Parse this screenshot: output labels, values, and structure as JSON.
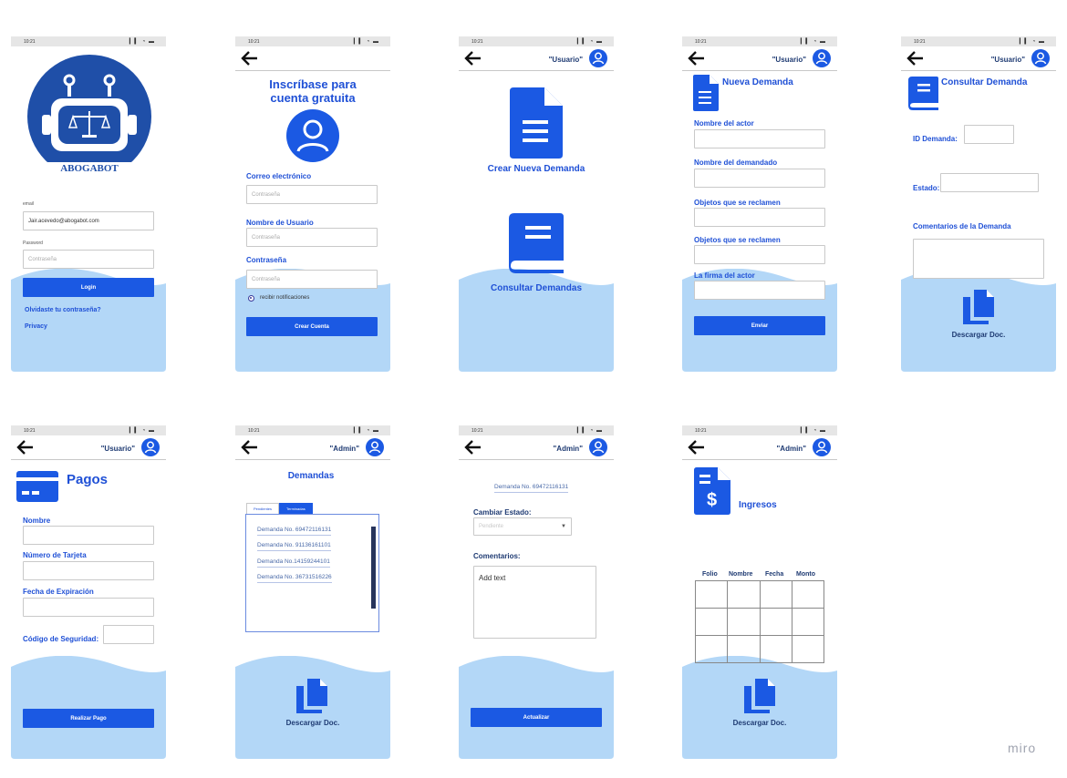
{
  "status_bar": {
    "time": "10:21",
    "signal": "▎▎ ● ▬"
  },
  "miro": "miro",
  "login": {
    "brand": "ABOGABOT",
    "email_label": "email",
    "email_value": "Jair.acevedo@abogabot.com",
    "password_label": "Password",
    "password_placeholder": "Contraseña",
    "login_button": "Login",
    "forgot_link": "Olvidaste tu contraseña?",
    "privacy_link": "Privacy"
  },
  "signup": {
    "title_line1": "Inscríbase para",
    "title_line2": "cuenta gratuita",
    "email_label": "Correo electrónico",
    "email_placeholder": "Contraseña",
    "username_label": "Nombre de Usuario",
    "username_placeholder": "Contraseña",
    "password_label": "Contraseña",
    "password_placeholder": "Contraseña",
    "notify_label": "recibir notificaciones",
    "create_button": "Crear Cuenta"
  },
  "home": {
    "user": "\"Usuario\"",
    "create_label": "Crear Nueva Demanda",
    "consult_label": "Consultar Demandas"
  },
  "new_demand": {
    "user": "\"Usuario\"",
    "title": "Nueva Demanda",
    "actor_label": "Nombre del actor",
    "defendant_label": "Nombre del demandado",
    "objects_label_1": "Objetos que se reclamen",
    "objects_label_2": "Objetos que se reclamen",
    "signature_label": "La firma del actor",
    "send_button": "Enviar"
  },
  "consult_demand": {
    "user": "\"Usuario\"",
    "title": "Consultar Demanda",
    "id_label": "ID Demanda:",
    "status_label": "Estado:",
    "comments_label": "Comentarios de la Demanda",
    "download_label": "Descargar Doc."
  },
  "payments": {
    "user": "\"Usuario\"",
    "title": "Pagos",
    "name_label": "Nombre",
    "card_label": "Número de Tarjeta",
    "expiry_label": "Fecha de Expiración",
    "security_label": "Código de Seguridad:",
    "pay_button": "Realizar Pago"
  },
  "admin_demands": {
    "user": "\"Admin\"",
    "title": "Demandas",
    "tab_pending": "Pendientes",
    "tab_done": "Terminadas",
    "items": [
      "Demanda No. 69472116131",
      "Demanda No. 91136161101",
      "Demanda No.14159244101",
      "Demanda No. 36731516226"
    ],
    "download_label": "Descargar Doc."
  },
  "admin_update": {
    "user": "\"Admin\"",
    "demand_no": "Demanda No. 69472116131",
    "change_status_label": "Cambiar Estado:",
    "status_value": "Pendiente",
    "comments_label": "Comentarios:",
    "comments_value": "Add text",
    "update_button": "Actualizar"
  },
  "admin_income": {
    "user": "\"Admin\"",
    "title": "Ingresos",
    "columns": [
      "Folio",
      "Nombre",
      "Fecha",
      "Monto"
    ],
    "download_label": "Descargar Doc."
  },
  "colors": {
    "accent": "#1b59e3",
    "wave": "#b3d7f7",
    "navy": "#1f3b73"
  }
}
